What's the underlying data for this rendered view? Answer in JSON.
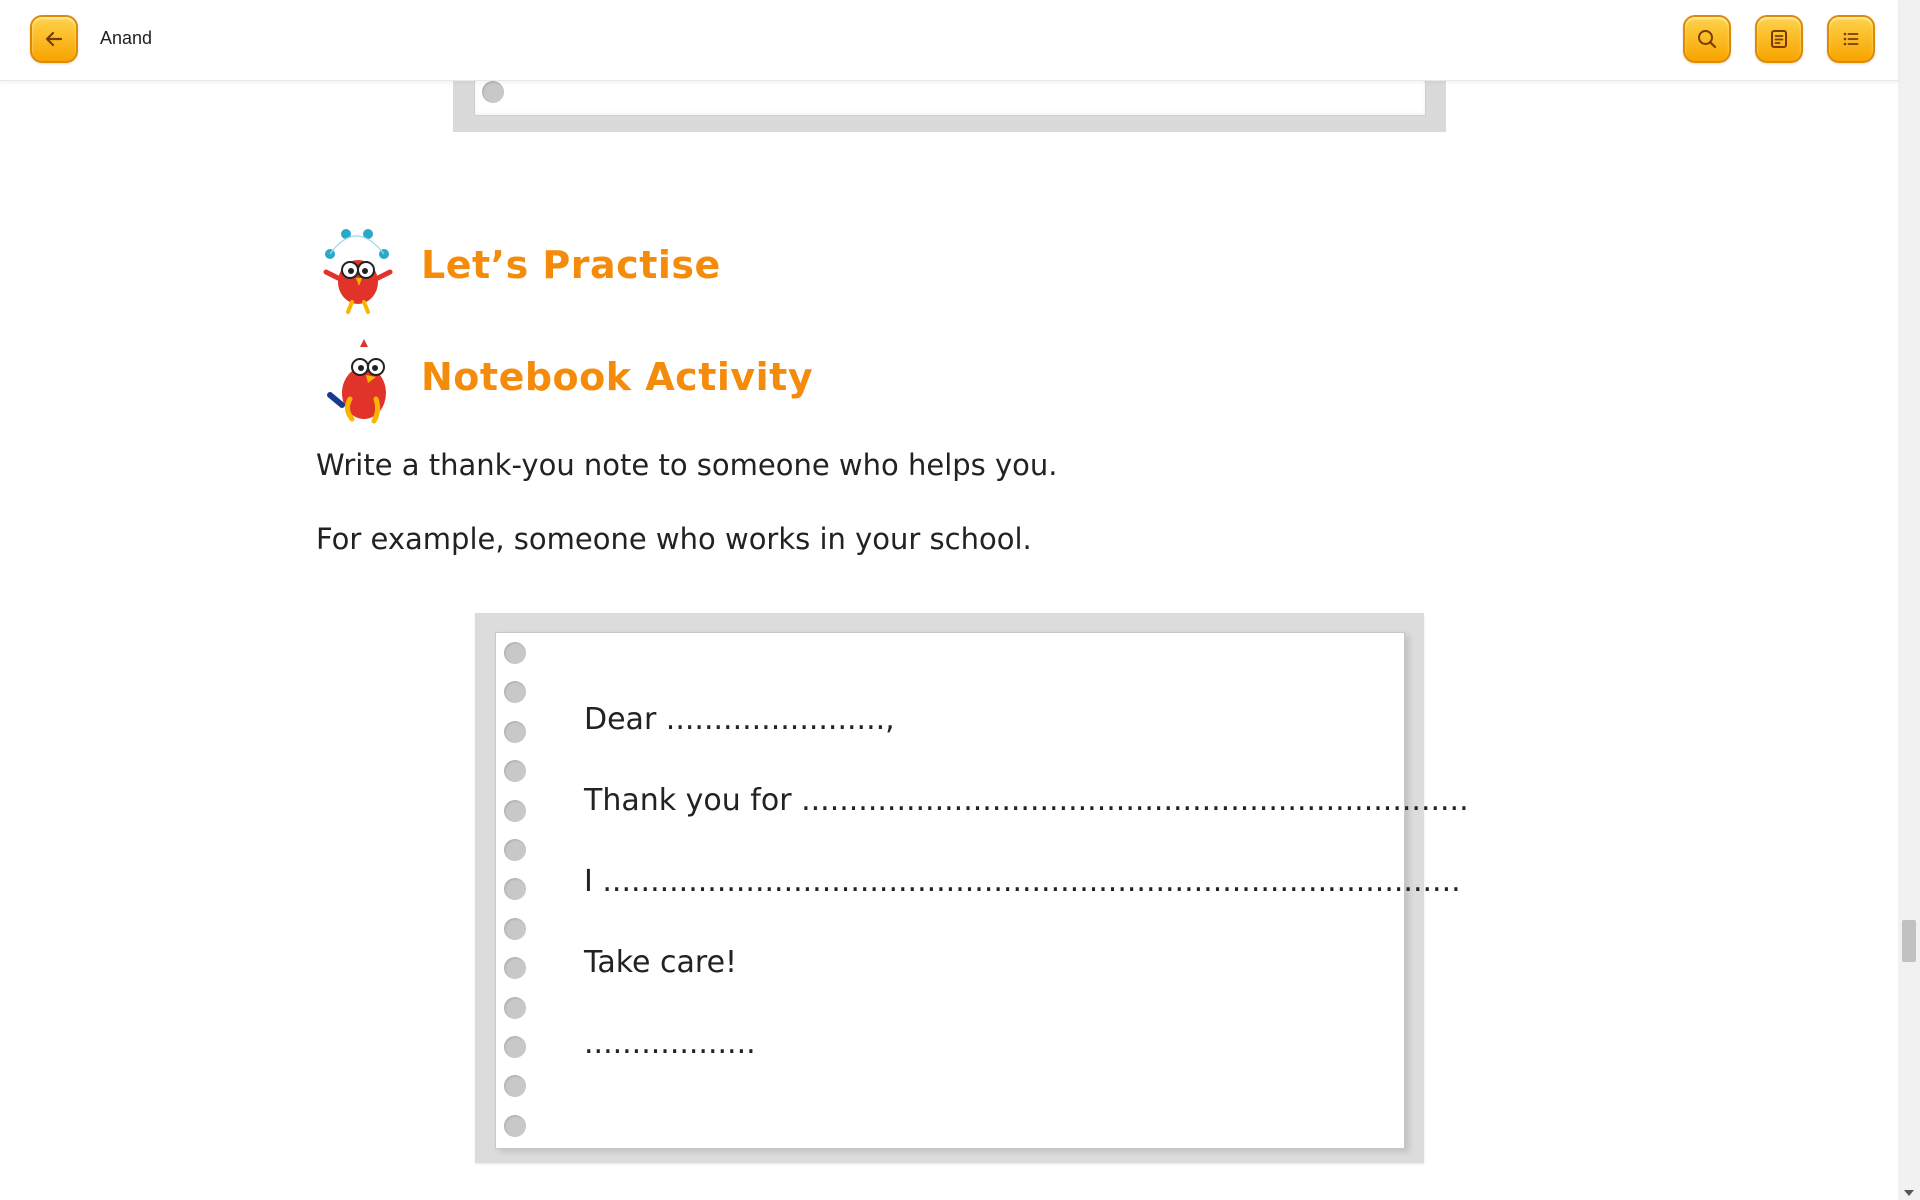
{
  "header": {
    "title": "Anand",
    "back_icon": "arrow-left-icon",
    "search_icon": "search-icon",
    "notes_icon": "note-icon",
    "toc_icon": "list-icon"
  },
  "content": {
    "practise_heading": "Let’s Practise",
    "activity_heading": "Notebook Activity",
    "instruction_1": "Write a thank-you note to someone who helps you.",
    "instruction_2": "For example, someone who works in your school."
  },
  "notebook": {
    "line_1": "Dear .......................,",
    "line_2": "Thank you for ......................................................................",
    "line_3": "I ..........................................................................................",
    "line_4": "Take care!",
    "line_5": ".................."
  },
  "colors": {
    "accent": "#f58b0a",
    "button_fill": "#fbb91a"
  }
}
